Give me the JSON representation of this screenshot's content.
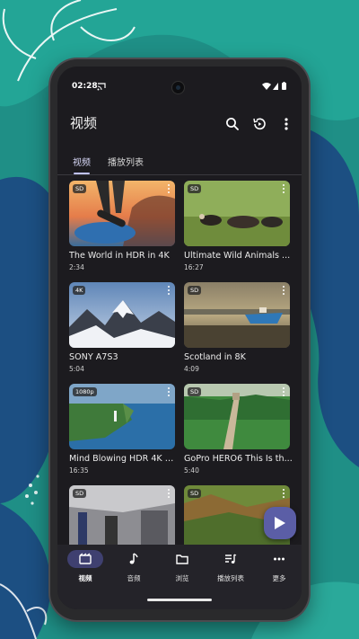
{
  "status_bar": {
    "time": "02:28"
  },
  "app_bar": {
    "title": "视频",
    "actions": [
      "search-icon",
      "history-icon",
      "more-vert-icon"
    ]
  },
  "tabs": [
    {
      "label": "视频",
      "active": true
    },
    {
      "label": "播放列表",
      "active": false
    }
  ],
  "videos": [
    {
      "title": "The World in HDR in 4K",
      "duration": "2:34",
      "badge": "SD"
    },
    {
      "title": "Ultimate Wild Animals ...",
      "duration": "16:27",
      "badge": "SD"
    },
    {
      "title": "SONY A7S3",
      "duration": "5:04",
      "badge": "4K"
    },
    {
      "title": "Scotland in 8K",
      "duration": "4:09",
      "badge": "SD"
    },
    {
      "title": "Mind Blowing HDR 4K 6...",
      "duration": "16:35",
      "badge": "1080p"
    },
    {
      "title": "GoPro HERO6 This Is th...",
      "duration": "5:40",
      "badge": "SD"
    },
    {
      "title": "",
      "duration": "",
      "badge": "SD"
    },
    {
      "title": "",
      "duration": "",
      "badge": "SD"
    }
  ],
  "bottom_nav": [
    {
      "label": "视频",
      "icon": "movie-icon",
      "active": true
    },
    {
      "label": "音频",
      "icon": "music-note-icon",
      "active": false
    },
    {
      "label": "浏览",
      "icon": "folder-icon",
      "active": false
    },
    {
      "label": "播放列表",
      "icon": "playlist-icon",
      "active": false
    },
    {
      "label": "更多",
      "icon": "more-horiz-icon",
      "active": false
    }
  ],
  "fab": {
    "icon": "play-icon"
  },
  "colors": {
    "background_teal": "#1f8f86",
    "background_blue": "#1c4f82",
    "screen": "#1c1b1f",
    "accent": "#bfc2ff",
    "fab": "#5b5ea6"
  }
}
